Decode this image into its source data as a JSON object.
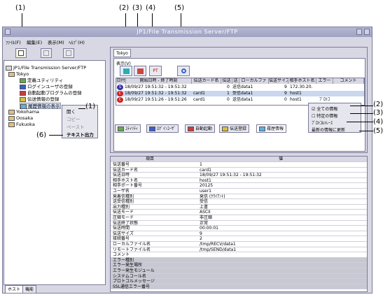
{
  "callouts": {
    "c1_top": "(1)",
    "c2": "(2)",
    "c3": "(3)",
    "c4": "(4)",
    "c5_top": "(5)",
    "c1_right": "(1)",
    "c6": "(6)",
    "r2": "(2)",
    "r3": "(3)",
    "r4": "(4)",
    "r5": "(5)"
  },
  "window": {
    "title": "JP1/File Transmission Server/FTP",
    "menu": [
      "ﾌｧｲﾙ(F)",
      "編集(E)",
      "表示(M)",
      "ﾍﾙﾌﾟ(H)"
    ]
  },
  "tree": {
    "root": "JP1/File Transmission Server/FTP",
    "host1": "Tokyo",
    "children": [
      "定義ユティリティ",
      "ログインユーザの登録",
      "自動起動プログラムの登録",
      "伝送情報の登録",
      "履歴情報の表示"
    ],
    "host2": "Yokohama",
    "host3": "Oosaka",
    "host4": "Fukuoka"
  },
  "context_menu": {
    "open": "開く",
    "copy": "コピー",
    "paste": "ペースト",
    "text_output": "テキスト出力"
  },
  "bottom_tabs": [
    "ホスト",
    "機能"
  ],
  "right_panel": {
    "tab": "Tokyo",
    "view_label": "表示(V)",
    "btn_pt": "PT"
  },
  "history_table": {
    "columns": [
      "日付",
      "開始日時 - 終了時刻",
      "伝送カード名",
      "伝送",
      "送",
      "ローカルファ",
      "伝送サイズ",
      "相手ホスト名",
      "エラー",
      "コメント"
    ],
    "rows": [
      [
        "S",
        "18/09/27 19:51:32 - 19:51:32",
        "",
        "0",
        "送信",
        "data1",
        "9",
        "172.30.20.",
        "",
        ""
      ],
      [
        "C",
        "18/09/27 19:51:32 - 19:51:32",
        "card1",
        "1",
        "受信",
        "data1",
        "9",
        "host1",
        "",
        ""
      ],
      [
        "C",
        "18/09/27 19:51:26 - 19:51:26",
        "card1",
        "0",
        "送信",
        "data1",
        "0",
        "host1",
        "ﾌﾟﾛﾄｺ",
        ""
      ]
    ]
  },
  "right_menu": {
    "all": "全ての情報",
    "specific": "特定の情報",
    "protocol": "ﾌﾟﾛﾄｺﾙﾄﾚｰｽ",
    "refresh": "最新の情報に更新"
  },
  "func_tabs": [
    "ﾕﾃｨﾘﾃｨ",
    "ﾛｸﾞｲﾝﾕｰｻﾞ",
    "自動起動",
    "伝送登録",
    "履歴情報"
  ],
  "detail": {
    "col_item": "項目",
    "col_value": "値",
    "rows": [
      [
        "伝送番号",
        "1"
      ],
      [
        "伝送カード名",
        "card1"
      ],
      [
        "伝送日時",
        "18/09/27 19:51:32 - 19:51:32"
      ],
      [
        "相手ホスト名",
        "host1"
      ],
      [
        "相手ポート番号",
        "20125"
      ],
      [
        "ユーザ名",
        "user1"
      ],
      [
        "発着信種別",
        "発信 (ｸﾗｲｱﾝﾄ)"
      ],
      [
        "送受信種別",
        "受信"
      ],
      [
        "出力種別",
        "上書"
      ],
      [
        "伝送モード",
        "ASCII"
      ],
      [
        "圧縮モード",
        "非圧縮"
      ],
      [
        "伝送終了状態",
        "正常"
      ],
      [
        "伝送時間",
        "00:00:01"
      ],
      [
        "伝送サイズ",
        "9"
      ],
      [
        "接続番号",
        "2"
      ],
      [
        "ローカルファイル名",
        "/tmp/RECV/data1"
      ],
      [
        "リモートファイル名",
        "/tmp/SEND/data1"
      ],
      [
        "コメント",
        ""
      ],
      [
        "エラー種別",
        ""
      ],
      [
        "エラー発生場所",
        ""
      ],
      [
        "エラー発生モジュール",
        ""
      ],
      [
        "システムコール名",
        ""
      ],
      [
        "プロトコルメッセージ",
        ""
      ],
      [
        "SSL通信エラー番号",
        ""
      ]
    ]
  },
  "colors": {
    "title_bar": "#9fa2c2",
    "selection": "#c9d7ef",
    "tree_selected": "#d8e6ff"
  }
}
